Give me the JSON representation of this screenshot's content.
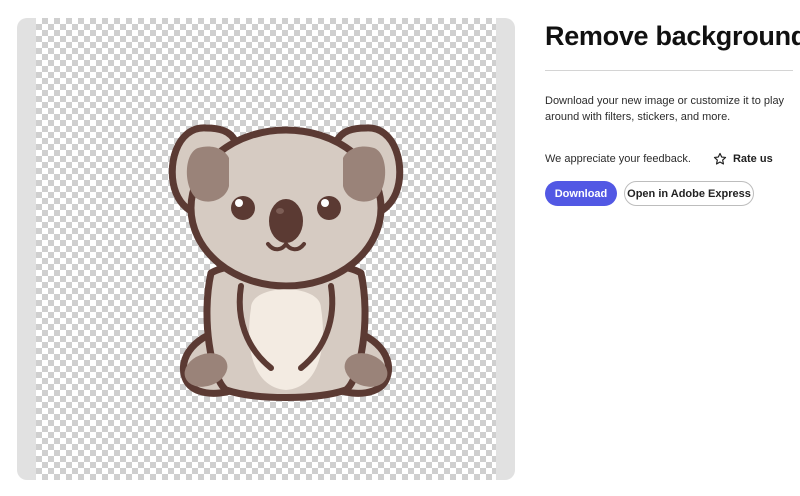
{
  "header": {
    "title": "Remove background"
  },
  "panel": {
    "description": "Download your new image or customize it to play around with filters, stickers, and more.",
    "feedback_text": "We appreciate your feedback.",
    "rate_label": "Rate us",
    "rate_icon": "star-outline-icon",
    "download_label": "Download",
    "open_express_label": "Open in Adobe Express"
  },
  "preview": {
    "image_subject": "koala",
    "background": "transparent-checkerboard"
  },
  "colors": {
    "accent": "#5258e4",
    "koala_outline": "#5b3a33",
    "koala_fur": "#d6cbc2",
    "koala_ear_inner": "#9a8379",
    "koala_belly": "#f3ebe2",
    "frame_bg": "#e1e1e1"
  }
}
